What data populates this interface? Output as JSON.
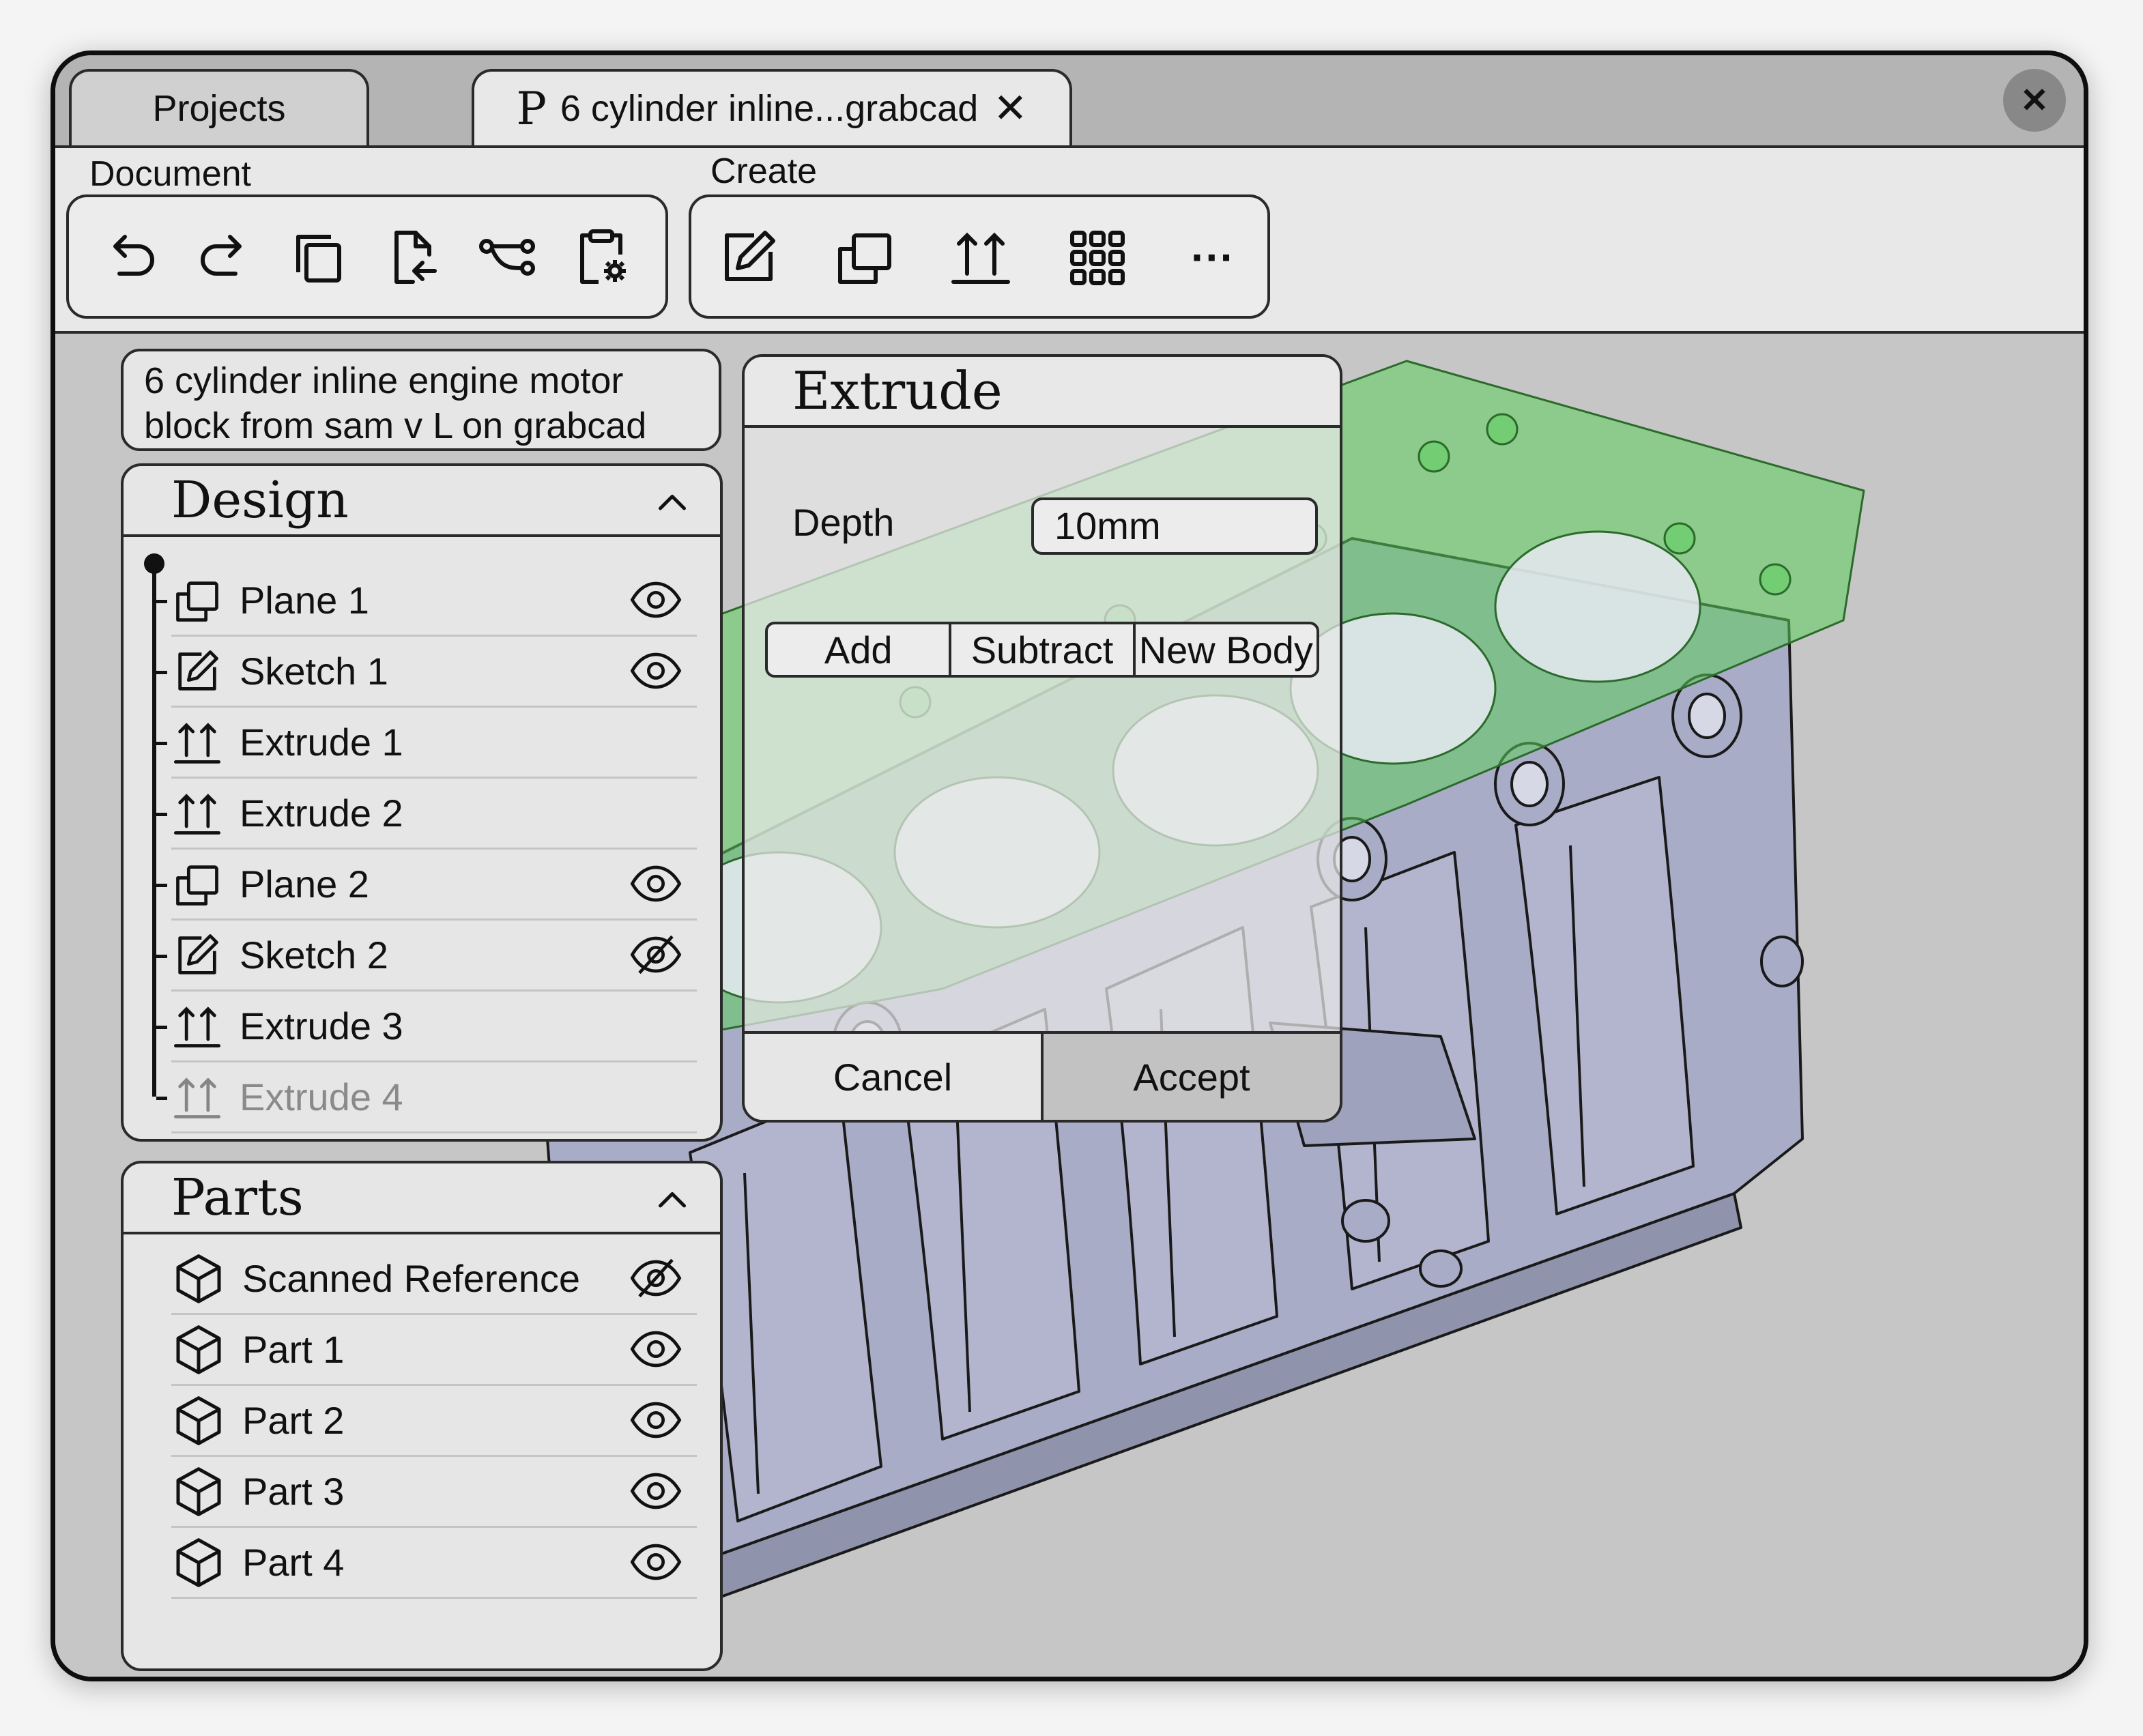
{
  "tabs": {
    "projects_label": "Projects",
    "active_prefix": "P",
    "active_label": "6 cylinder inline...grabcad",
    "close_tab_glyph": "✕"
  },
  "window": {
    "close_glyph": "✕"
  },
  "toolbar": {
    "document_title": "Document",
    "create_title": "Create",
    "document_tools": [
      "undo-icon",
      "redo-icon",
      "copy-icon",
      "import-icon",
      "graph-icon",
      "settings-clipboard-icon"
    ],
    "create_tools": [
      "sketch-icon",
      "plane-icon",
      "extrude-icon",
      "pattern-grid-icon",
      "more-icon"
    ],
    "more_glyph": "···"
  },
  "project": {
    "description": "6 cylinder inline engine motor block from sam v L on grabcad"
  },
  "design_panel": {
    "title": "Design",
    "items": [
      {
        "label": "Plane 1",
        "icon": "plane-icon",
        "visibility": "visible"
      },
      {
        "label": "Sketch 1",
        "icon": "sketch-icon",
        "visibility": "visible"
      },
      {
        "label": "Extrude 1",
        "icon": "extrude-icon",
        "visibility": "none"
      },
      {
        "label": "Extrude 2",
        "icon": "extrude-icon",
        "visibility": "none"
      },
      {
        "label": "Plane 2",
        "icon": "plane-icon",
        "visibility": "visible"
      },
      {
        "label": "Sketch 2",
        "icon": "sketch-icon",
        "visibility": "hidden"
      },
      {
        "label": "Extrude 3",
        "icon": "extrude-icon",
        "visibility": "none"
      },
      {
        "label": "Extrude 4",
        "icon": "extrude-icon",
        "visibility": "none",
        "faded": true
      }
    ]
  },
  "parts_panel": {
    "title": "Parts",
    "items": [
      {
        "label": "Scanned Reference",
        "visibility": "hidden"
      },
      {
        "label": "Part 1",
        "visibility": "visible"
      },
      {
        "label": "Part 2",
        "visibility": "visible"
      },
      {
        "label": "Part 3",
        "visibility": "visible"
      },
      {
        "label": "Part 4",
        "visibility": "visible"
      }
    ]
  },
  "extrude_dialog": {
    "title": "Extrude",
    "depth_label": "Depth",
    "depth_value": "10mm",
    "modes": [
      "Add",
      "Subtract",
      "New Body"
    ],
    "cancel_label": "Cancel",
    "accept_label": "Accept"
  },
  "colors": {
    "model_body": "#a9acc6",
    "model_highlight": "#5fcf5f",
    "viewport_bg": "#c6c6c6"
  }
}
